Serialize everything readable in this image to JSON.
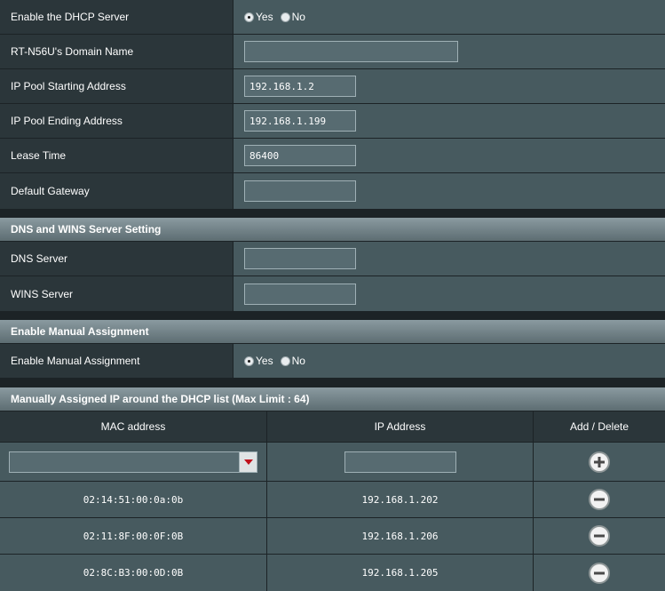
{
  "dhcp": {
    "enable_label": "Enable the DHCP Server",
    "yes": "Yes",
    "no": "No",
    "domain_label": "RT-N56U's Domain Name",
    "domain_value": "",
    "pool_start_label": "IP Pool Starting Address",
    "pool_start_value": "192.168.1.2",
    "pool_end_label": "IP Pool Ending Address",
    "pool_end_value": "192.168.1.199",
    "lease_label": "Lease Time",
    "lease_value": "86400",
    "gateway_label": "Default Gateway",
    "gateway_value": ""
  },
  "dns_section": {
    "title": "DNS and WINS Server Setting",
    "dns_label": "DNS Server",
    "dns_value": "",
    "wins_label": "WINS Server",
    "wins_value": ""
  },
  "manual_section": {
    "title": "Enable Manual Assignment",
    "enable_label": "Enable Manual Assignment",
    "yes": "Yes",
    "no": "No"
  },
  "list_section": {
    "title": "Manually Assigned IP around the DHCP list (Max Limit : 64)",
    "headers": [
      "MAC address",
      "IP Address",
      "Add / Delete"
    ],
    "new_mac": "",
    "new_ip": "",
    "rows": [
      {
        "mac": "02:14:51:00:0a:0b",
        "ip": "192.168.1.202"
      },
      {
        "mac": "02:11:8F:00:0F:0B",
        "ip": "192.168.1.206"
      },
      {
        "mac": "02:8C:B3:00:0D:0B",
        "ip": "192.168.1.205"
      }
    ]
  },
  "icons": {
    "add": "plus-circle-icon",
    "delete": "minus-circle-icon",
    "dropdown": "triangle-down-icon"
  },
  "colors": {
    "label_bg": "#2b363a",
    "value_bg": "#475a5f",
    "header_gradient_top": "#8a9aa0",
    "dropdown_arrow": "#c0121c"
  }
}
